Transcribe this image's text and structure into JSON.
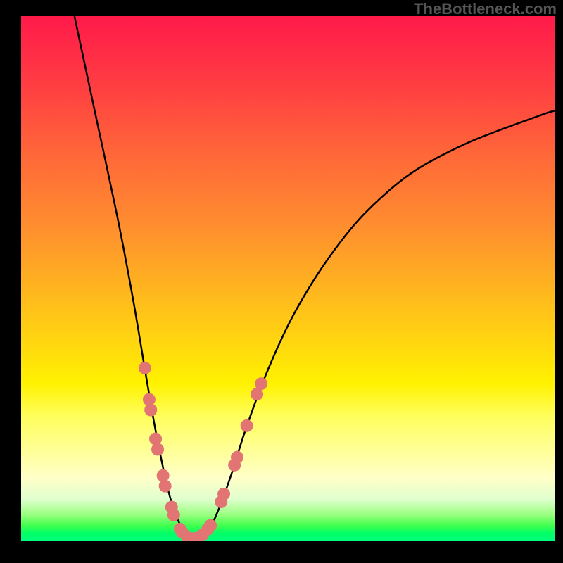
{
  "attribution": "TheBottleneck.com",
  "colors": {
    "gradient_top": "#ff1a4a",
    "gradient_bottom": "#00ff7e",
    "curve": "#000000",
    "data_points": "#e27474",
    "background": "#000000"
  },
  "chart_data": {
    "type": "line",
    "title": "",
    "xlabel": "",
    "ylabel": "",
    "xlim": [
      0,
      100
    ],
    "ylim": [
      0,
      100
    ],
    "curve_left": {
      "comment": "Steep descending curve from upper-left to valley floor",
      "points": [
        {
          "x": 10,
          "y": 100
        },
        {
          "x": 14,
          "y": 81
        },
        {
          "x": 18,
          "y": 62
        },
        {
          "x": 21,
          "y": 46
        },
        {
          "x": 23,
          "y": 34
        },
        {
          "x": 24.5,
          "y": 25
        },
        {
          "x": 26,
          "y": 17
        },
        {
          "x": 27.5,
          "y": 10
        },
        {
          "x": 29,
          "y": 5
        },
        {
          "x": 30.5,
          "y": 2
        },
        {
          "x": 32,
          "y": 0.5
        }
      ]
    },
    "curve_right": {
      "comment": "Ascending curve from valley floor to right side, leveling off",
      "points": [
        {
          "x": 32,
          "y": 0.5
        },
        {
          "x": 35,
          "y": 2
        },
        {
          "x": 37,
          "y": 6
        },
        {
          "x": 39.5,
          "y": 13
        },
        {
          "x": 42,
          "y": 21
        },
        {
          "x": 46,
          "y": 32
        },
        {
          "x": 51,
          "y": 43
        },
        {
          "x": 57,
          "y": 53
        },
        {
          "x": 64,
          "y": 62
        },
        {
          "x": 73,
          "y": 70
        },
        {
          "x": 84,
          "y": 76
        },
        {
          "x": 97,
          "y": 81
        },
        {
          "x": 100,
          "y": 82
        }
      ]
    },
    "data_points": [
      {
        "x": 23.2,
        "y": 33
      },
      {
        "x": 24.0,
        "y": 27
      },
      {
        "x": 24.3,
        "y": 25
      },
      {
        "x": 25.2,
        "y": 19.5
      },
      {
        "x": 25.6,
        "y": 17.5
      },
      {
        "x": 26.6,
        "y": 12.5
      },
      {
        "x": 27.0,
        "y": 10.5
      },
      {
        "x": 28.2,
        "y": 6.5
      },
      {
        "x": 28.6,
        "y": 5
      },
      {
        "x": 29.8,
        "y": 2.3
      },
      {
        "x": 30.2,
        "y": 1.7
      },
      {
        "x": 31.2,
        "y": 0.7
      },
      {
        "x": 32.2,
        "y": 0.5
      },
      {
        "x": 33.0,
        "y": 0.6
      },
      {
        "x": 34.0,
        "y": 1.2
      },
      {
        "x": 35.0,
        "y": 2.3
      },
      {
        "x": 35.5,
        "y": 3
      },
      {
        "x": 37.5,
        "y": 7.5
      },
      {
        "x": 38.0,
        "y": 9
      },
      {
        "x": 40.0,
        "y": 14.5
      },
      {
        "x": 40.5,
        "y": 16
      },
      {
        "x": 42.3,
        "y": 22
      },
      {
        "x": 44.2,
        "y": 28
      },
      {
        "x": 45.0,
        "y": 30
      }
    ]
  }
}
